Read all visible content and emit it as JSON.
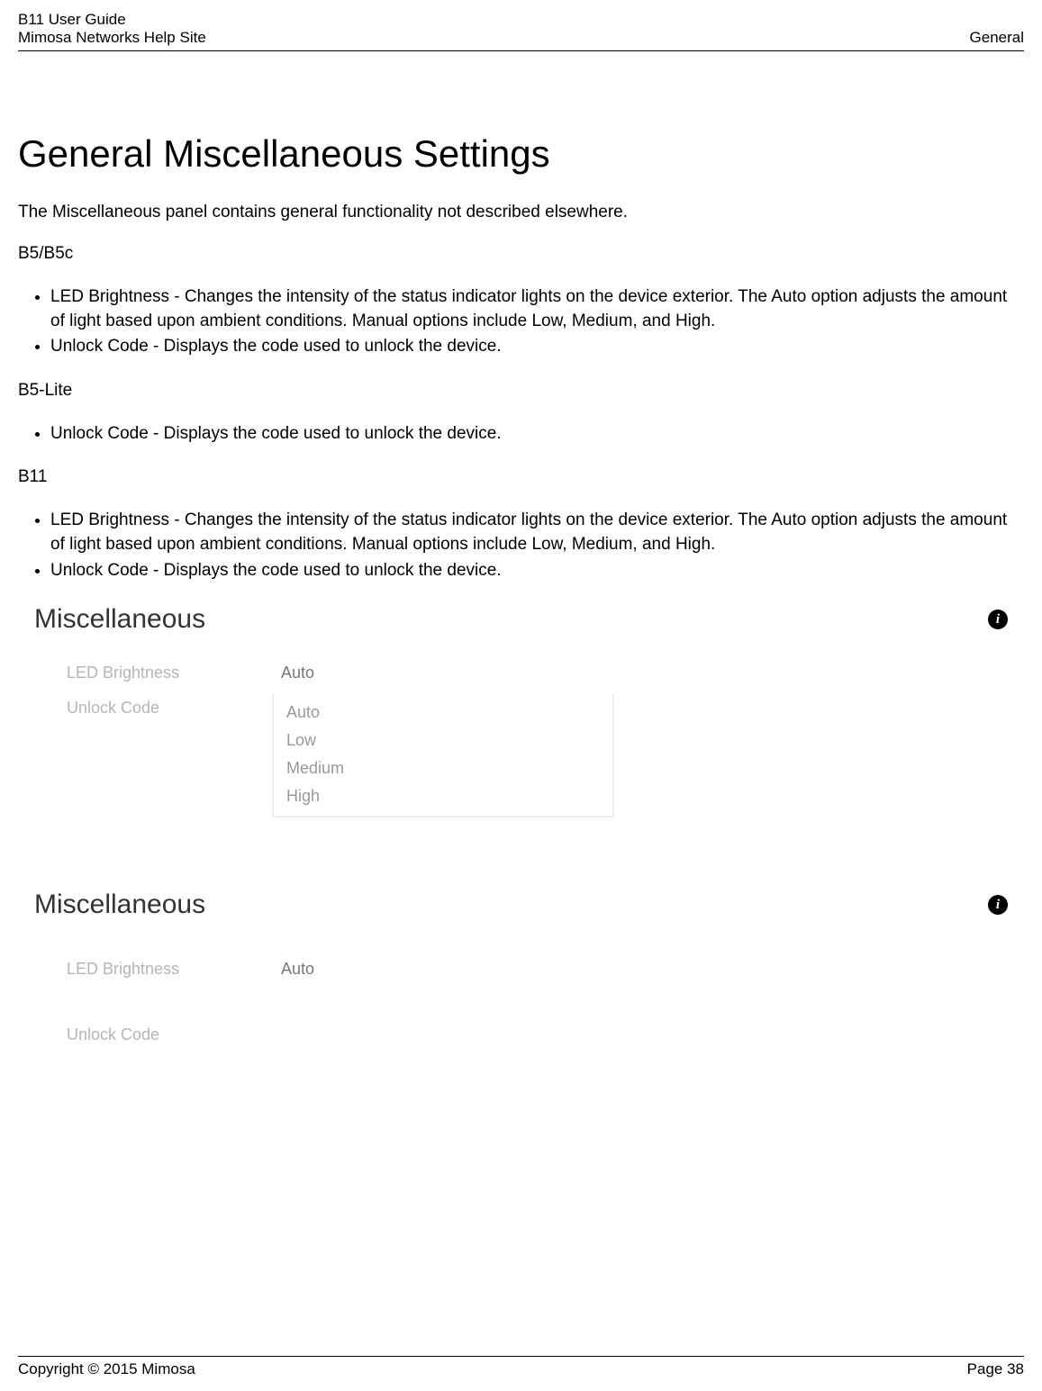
{
  "header": {
    "guide_title": "B11 User Guide",
    "site_name": "Mimosa Networks Help Site",
    "section": "General"
  },
  "page": {
    "title": "General Miscellaneous Settings",
    "intro": "The Miscellaneous panel contains general functionality not described elsewhere.",
    "sections": {
      "b5": {
        "label": "B5/B5c",
        "items": [
          "LED Brightness - Changes the intensity of the status indicator lights on the device exterior. The Auto option adjusts the amount of light based upon ambient conditions. Manual options include Low, Medium, and High.",
          "Unlock Code - Displays the code used to unlock the device."
        ]
      },
      "b5lite": {
        "label": "B5-Lite",
        "items": [
          "Unlock Code - Displays the code used to unlock the device."
        ]
      },
      "b11": {
        "label": "B11",
        "items": [
          "LED Brightness - Changes the intensity of the status indicator lights on the device exterior. The Auto option adjusts the amount of light based upon ambient conditions. Manual options include Low, Medium, and High.",
          "Unlock Code - Displays the code used to unlock the device."
        ]
      }
    }
  },
  "panel1": {
    "title": "Miscellaneous",
    "led_label": "LED Brightness",
    "led_value": "Auto",
    "unlock_label": "Unlock Code",
    "options": [
      "Auto",
      "Low",
      "Medium",
      "High"
    ]
  },
  "panel2": {
    "title": "Miscellaneous",
    "led_label": "LED Brightness",
    "led_value": "Auto",
    "unlock_label": "Unlock Code"
  },
  "footer": {
    "copyright": "Copyright © 2015 Mimosa",
    "page": "Page 38"
  }
}
